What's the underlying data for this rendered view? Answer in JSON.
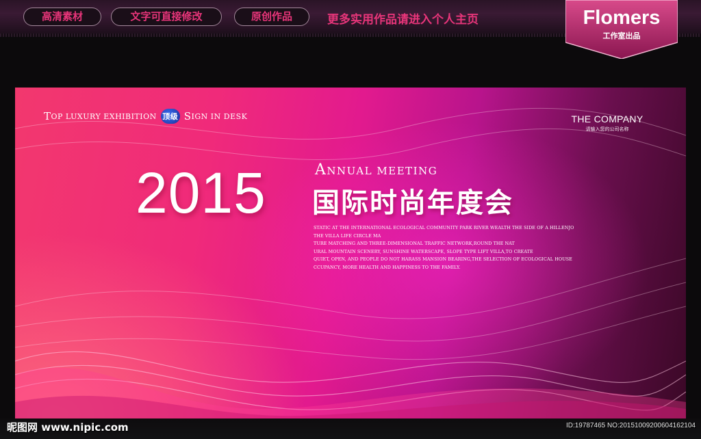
{
  "header": {
    "tags": [
      "高清素材",
      "文字可直接修改",
      "原创作品"
    ],
    "promo_text": "更多实用作品请进入个人主页",
    "brand": {
      "name": "Flomers",
      "sub": "工作室出品"
    }
  },
  "banner": {
    "tagline": {
      "left": [
        "T",
        "OP LUXURY EXHIBITION"
      ],
      "badge": "顶级",
      "right": [
        "S",
        "IGN IN DESK"
      ]
    },
    "company": {
      "name": "THE COMPANY",
      "sub": "请输入您的公司名称"
    },
    "year": "2015",
    "subtitle_en": [
      "A",
      "NNUAL MEETING"
    ],
    "title_cn": "国际时尚年度会",
    "description_lines": [
      "STATIC AT THE INTERNATIONAL ECOLOGICAL COMMUNITY PARK RIVER WEALTH THE SIDE OF A HILLENJOY",
      "THE VILLA LIFE CIRCLE MA",
      "TURE MATCHING AND THREE-DIMENSIONAL TRAFFIC NETWORK,ROUND THE NAT",
      "URAL MOUNTAIN SCENERY, SUNSHINE WATERSCAPE, SLOPE TYPE LIFT VILLA,TO CREATE",
      "QUIET, OPEN, AND PEOPLE DO NOT HARASS MANSION BEARING,THE SELECTION OF ECOLOGICAL HOUSE O",
      "CCUPANCY, MORE HEALTH AND HAPPINESS TO THE FAMILY."
    ]
  },
  "footer": {
    "watermark": "昵图网 www.nipic.com",
    "image_id": "ID:19787465 NO:20151009200604162104"
  }
}
